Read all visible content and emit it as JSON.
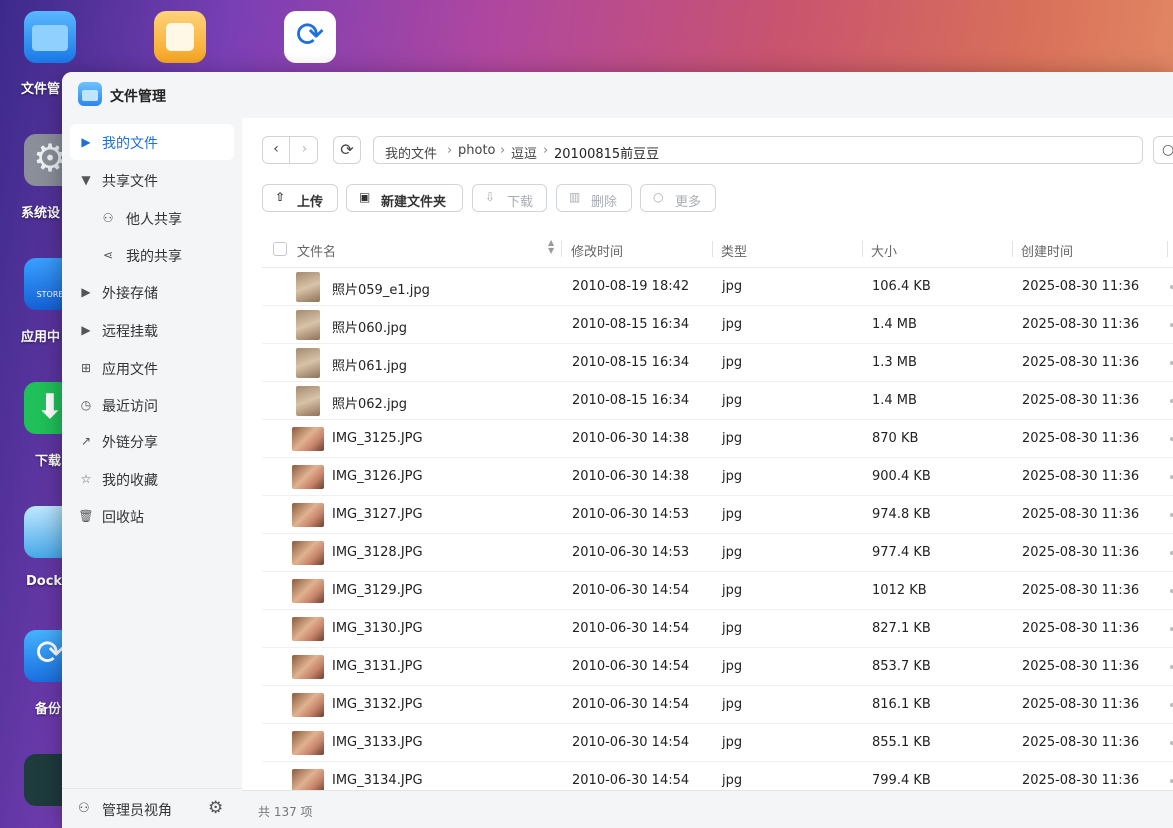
{
  "desktop": {
    "icons": [
      {
        "name": "文件管"
      },
      {
        "name": "系统设"
      },
      {
        "name": "应用中"
      },
      {
        "name": "下载"
      },
      {
        "name": "Docke"
      },
      {
        "name": "备份"
      }
    ]
  },
  "window": {
    "title": "文件管理"
  },
  "sidebar": {
    "items": [
      {
        "label": "我的文件",
        "icon": "caret-right-icon"
      },
      {
        "label": "共享文件",
        "icon": "caret-down-icon"
      },
      {
        "label": "他人共享",
        "icon": "users-icon"
      },
      {
        "label": "我的共享",
        "icon": "share-icon"
      },
      {
        "label": "外接存储",
        "icon": "caret-right-icon"
      },
      {
        "label": "远程挂载",
        "icon": "caret-right-icon"
      },
      {
        "label": "应用文件",
        "icon": "grid-icon"
      },
      {
        "label": "最近访问",
        "icon": "clock-icon"
      },
      {
        "label": "外链分享",
        "icon": "link-share-icon"
      },
      {
        "label": "我的收藏",
        "icon": "star-icon"
      },
      {
        "label": "回收站",
        "icon": "trash-icon"
      }
    ],
    "footer": {
      "admin_label": "管理员视角"
    }
  },
  "breadcrumb": [
    "我的文件",
    "photo",
    "逗逗",
    "20100815前豆豆"
  ],
  "toolbar": {
    "upload": "上传",
    "new_folder": "新建文件夹",
    "download": "下载",
    "delete": "删除",
    "more": "更多"
  },
  "table": {
    "columns": {
      "name": "文件名",
      "modified": "修改时间",
      "type": "类型",
      "size": "大小",
      "created": "创建时间"
    },
    "rows": [
      {
        "name": "照片059_e1.jpg",
        "modified": "2010-08-19 18:42",
        "type": "jpg",
        "size": "106.4 KB",
        "created": "2025-08-30 11:36"
      },
      {
        "name": "照片060.jpg",
        "modified": "2010-08-15 16:34",
        "type": "jpg",
        "size": "1.4 MB",
        "created": "2025-08-30 11:36"
      },
      {
        "name": "照片061.jpg",
        "modified": "2010-08-15 16:34",
        "type": "jpg",
        "size": "1.3 MB",
        "created": "2025-08-30 11:36"
      },
      {
        "name": "照片062.jpg",
        "modified": "2010-08-15 16:34",
        "type": "jpg",
        "size": "1.4 MB",
        "created": "2025-08-30 11:36"
      },
      {
        "name": "IMG_3125.JPG",
        "modified": "2010-06-30 14:38",
        "type": "jpg",
        "size": "870 KB",
        "created": "2025-08-30 11:36"
      },
      {
        "name": "IMG_3126.JPG",
        "modified": "2010-06-30 14:38",
        "type": "jpg",
        "size": "900.4 KB",
        "created": "2025-08-30 11:36"
      },
      {
        "name": "IMG_3127.JPG",
        "modified": "2010-06-30 14:53",
        "type": "jpg",
        "size": "974.8 KB",
        "created": "2025-08-30 11:36"
      },
      {
        "name": "IMG_3128.JPG",
        "modified": "2010-06-30 14:53",
        "type": "jpg",
        "size": "977.4 KB",
        "created": "2025-08-30 11:36"
      },
      {
        "name": "IMG_3129.JPG",
        "modified": "2010-06-30 14:54",
        "type": "jpg",
        "size": "1012 KB",
        "created": "2025-08-30 11:36"
      },
      {
        "name": "IMG_3130.JPG",
        "modified": "2010-06-30 14:54",
        "type": "jpg",
        "size": "827.1 KB",
        "created": "2025-08-30 11:36"
      },
      {
        "name": "IMG_3131.JPG",
        "modified": "2010-06-30 14:54",
        "type": "jpg",
        "size": "853.7 KB",
        "created": "2025-08-30 11:36"
      },
      {
        "name": "IMG_3132.JPG",
        "modified": "2010-06-30 14:54",
        "type": "jpg",
        "size": "816.1 KB",
        "created": "2025-08-30 11:36"
      },
      {
        "name": "IMG_3133.JPG",
        "modified": "2010-06-30 14:54",
        "type": "jpg",
        "size": "855.1 KB",
        "created": "2025-08-30 11:36"
      },
      {
        "name": "IMG_3134.JPG",
        "modified": "2010-06-30 14:54",
        "type": "jpg",
        "size": "799.4 KB",
        "created": "2025-08-30 11:36"
      }
    ]
  },
  "status": {
    "count_text": "共 137 项"
  }
}
